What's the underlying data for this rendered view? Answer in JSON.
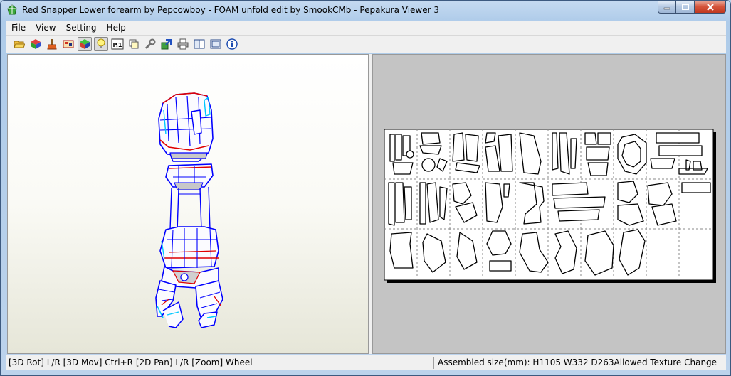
{
  "window": {
    "title": "Red Snapper Lower forearm by Pepcowboy - FOAM unfold edit by SmookCMb - Pepakura Viewer 3"
  },
  "menu": [
    "File",
    "View",
    "Setting",
    "Help"
  ],
  "toolbar": {
    "buttons": [
      {
        "name": "open-icon"
      },
      {
        "name": "3d-model-icon"
      },
      {
        "name": "paint-brush-icon"
      },
      {
        "name": "texture-icon"
      },
      {
        "name": "color-cube-icon"
      },
      {
        "name": "lightbulb-icon"
      },
      {
        "name": "page-number-icon",
        "label": "P.1"
      },
      {
        "name": "tabs-icon"
      },
      {
        "name": "wrench-icon"
      },
      {
        "name": "export-icon"
      },
      {
        "name": "printer-icon"
      },
      {
        "name": "single-pane-icon"
      },
      {
        "name": "split-pane-icon"
      },
      {
        "name": "info-icon"
      }
    ]
  },
  "status": {
    "left": "[3D Rot] L/R [3D Mov] Ctrl+R [2D Pan] L/R [Zoom] Wheel",
    "right": "Assembled size(mm): H1105 W332 D263Allowed Texture Change"
  },
  "colors": {
    "edge_blue": "#0000ff",
    "edge_red": "#e00000",
    "edge_cyan": "#00c8ff",
    "pane_2d_bg": "#c4c4c4"
  }
}
